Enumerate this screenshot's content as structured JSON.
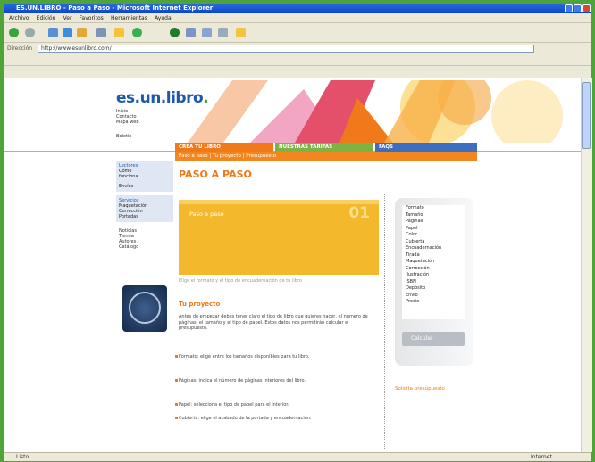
{
  "window": {
    "title": "ES.UN.LIBRO - Paso a Paso - Microsoft Internet Explorer"
  },
  "menu": [
    "Archivo",
    "Edición",
    "Ver",
    "Favoritos",
    "Herramientas",
    "Ayuda"
  ],
  "address": {
    "label": "Dirección",
    "url": "http://www.esunlibro.com/"
  },
  "site": {
    "logo_main": "es.un.libro",
    "logo_dot": ".",
    "small_nav": [
      "Inicio",
      "Contacto",
      "Mapa web",
      "Boletín"
    ],
    "tabs": [
      "CREA TU LIBRO",
      "NUESTRAS TARIFAS",
      "FAQS"
    ],
    "subnav": "Paso a paso  |  Tu proyecto  |  Presupuesto"
  },
  "left": {
    "box1": {
      "title": "Lectores",
      "lines": [
        "Cómo",
        "funciona",
        "Envíos"
      ]
    },
    "box2": {
      "title": "Servicios",
      "lines": [
        "Maquetación",
        "Corrección",
        "Portadas"
      ]
    },
    "links": [
      "Noticias",
      "Tienda",
      "Autores",
      "Catálogo"
    ]
  },
  "main": {
    "title": "PASO A PASO",
    "step_label": "Paso a paso",
    "step_number": "01",
    "caption": "Elige el formato y el tipo de encuadernación de tu libro",
    "section_title": "Tu proyecto",
    "para1": "Antes de empezar debes tener claro el tipo de libro que quieres hacer, el número de páginas, el tamaño y el tipo de papel. Estos datos nos permitirán calcular el presupuesto.",
    "bullets": [
      "Formato: elige entre los tamaños disponibles para tu libro.",
      "Páginas: indica el número de páginas interiores del libro.",
      "Papel: selecciona el tipo de papel para el interior.",
      "Cubierta: elige el acabado de la portada y encuadernación."
    ]
  },
  "right": {
    "items": [
      "Formato",
      "Tamaño",
      "Páginas",
      "Papel",
      "Color",
      "Cubierta",
      "Encuadernación",
      "Tirada",
      "Maquetación",
      "Corrección",
      "Ilustración",
      "ISBN",
      "Depósito",
      "Envío",
      "Precio"
    ],
    "button": "Calcular",
    "link": "Solicita presupuesto"
  },
  "status": {
    "text": "Listo",
    "zone": "Internet"
  },
  "colors": {
    "orange": "#f07a1a",
    "blue": "#1f5aa8",
    "yellow": "#f3b82c",
    "green_tab": "#7cb342",
    "blue_tab": "#3d6fc1"
  }
}
